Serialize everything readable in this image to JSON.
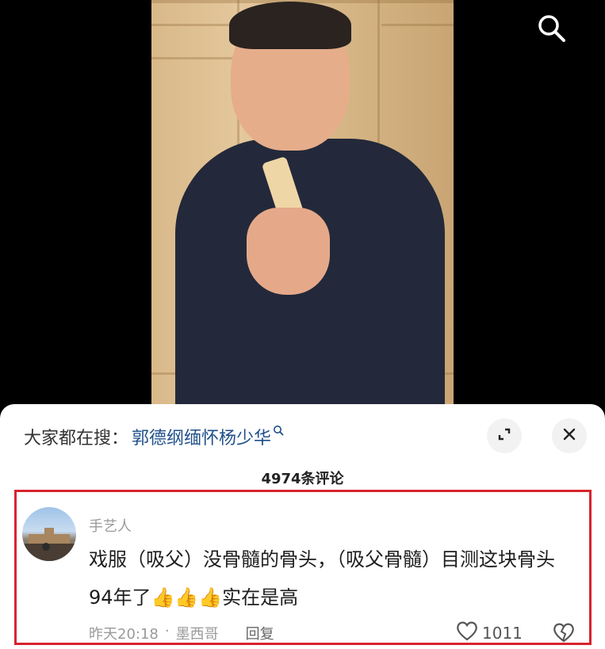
{
  "video": {
    "search_icon": "search-icon"
  },
  "sheet": {
    "hot_search_prefix": "大家都在搜：",
    "hot_search_term": "郭德纲缅怀杨少华",
    "expand_icon": "expand-icon",
    "close_icon": "close-icon",
    "comment_count": "4974条评论"
  },
  "comment": {
    "username": "手艺人",
    "text": "戏服（吸父）没骨髓的骨头，（吸父骨髓）目测这块骨头94年了👍👍👍实在是高",
    "time": "昨天20:18",
    "separator": "·",
    "location": "墨西哥",
    "reply_label": "回复",
    "like_count": "1011",
    "highlight_color": "#d8232e"
  }
}
